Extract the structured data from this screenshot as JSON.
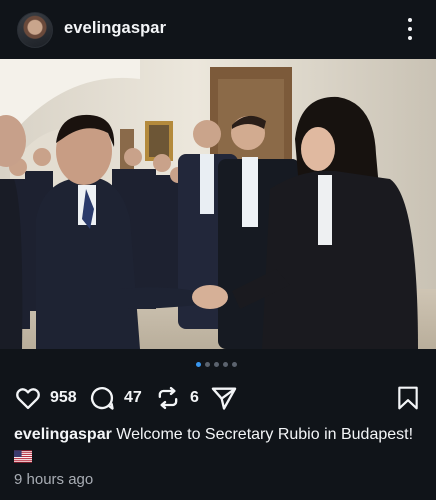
{
  "post": {
    "username": "evelingaspar",
    "caption_text": "Welcome to Secretary Rubio in Budapest!",
    "flag_emoji": "🇺🇸",
    "time_ago": "9 hours ago",
    "carousel_count": 5,
    "carousel_active_index": 0
  },
  "actions": {
    "likes": "958",
    "comments": "47",
    "reposts": "6",
    "like_icon": "heart-icon",
    "comment_icon": "comment-bubble-icon",
    "repost_icon": "repost-icon",
    "share_icon": "send-icon",
    "save_icon": "bookmark-icon"
  },
  "colors": {
    "background": "#101419",
    "text": "#f3f5f7",
    "muted": "#a8adb4",
    "accent": "#3897f0"
  }
}
